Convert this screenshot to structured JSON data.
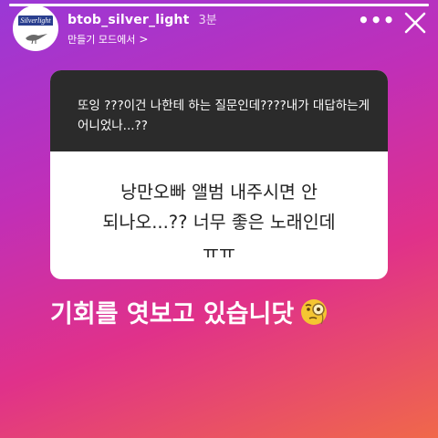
{
  "story": {
    "progress": 1.0
  },
  "header": {
    "avatar_text": "Silverlight",
    "username": "btob_silver_light",
    "time": "3분",
    "subtitle": "만들기 모드에서",
    "chevron": ">"
  },
  "question_card": {
    "question": "또잉 ???이건 나한테 하는 질문인데????내가 대답하는게 어니었나...??",
    "answer_line1": "낭만오빠 앨범 내주시면 안",
    "answer_line2": "되나오...?? 너무 좋은 노래인데",
    "answer_line3": "ㅠㅠ"
  },
  "caption": {
    "text": "기회를 엿보고 있습니닷"
  },
  "icons": {
    "more": "more-options-icon",
    "close": "close-icon",
    "emoji": "face-with-monocle-icon"
  }
}
